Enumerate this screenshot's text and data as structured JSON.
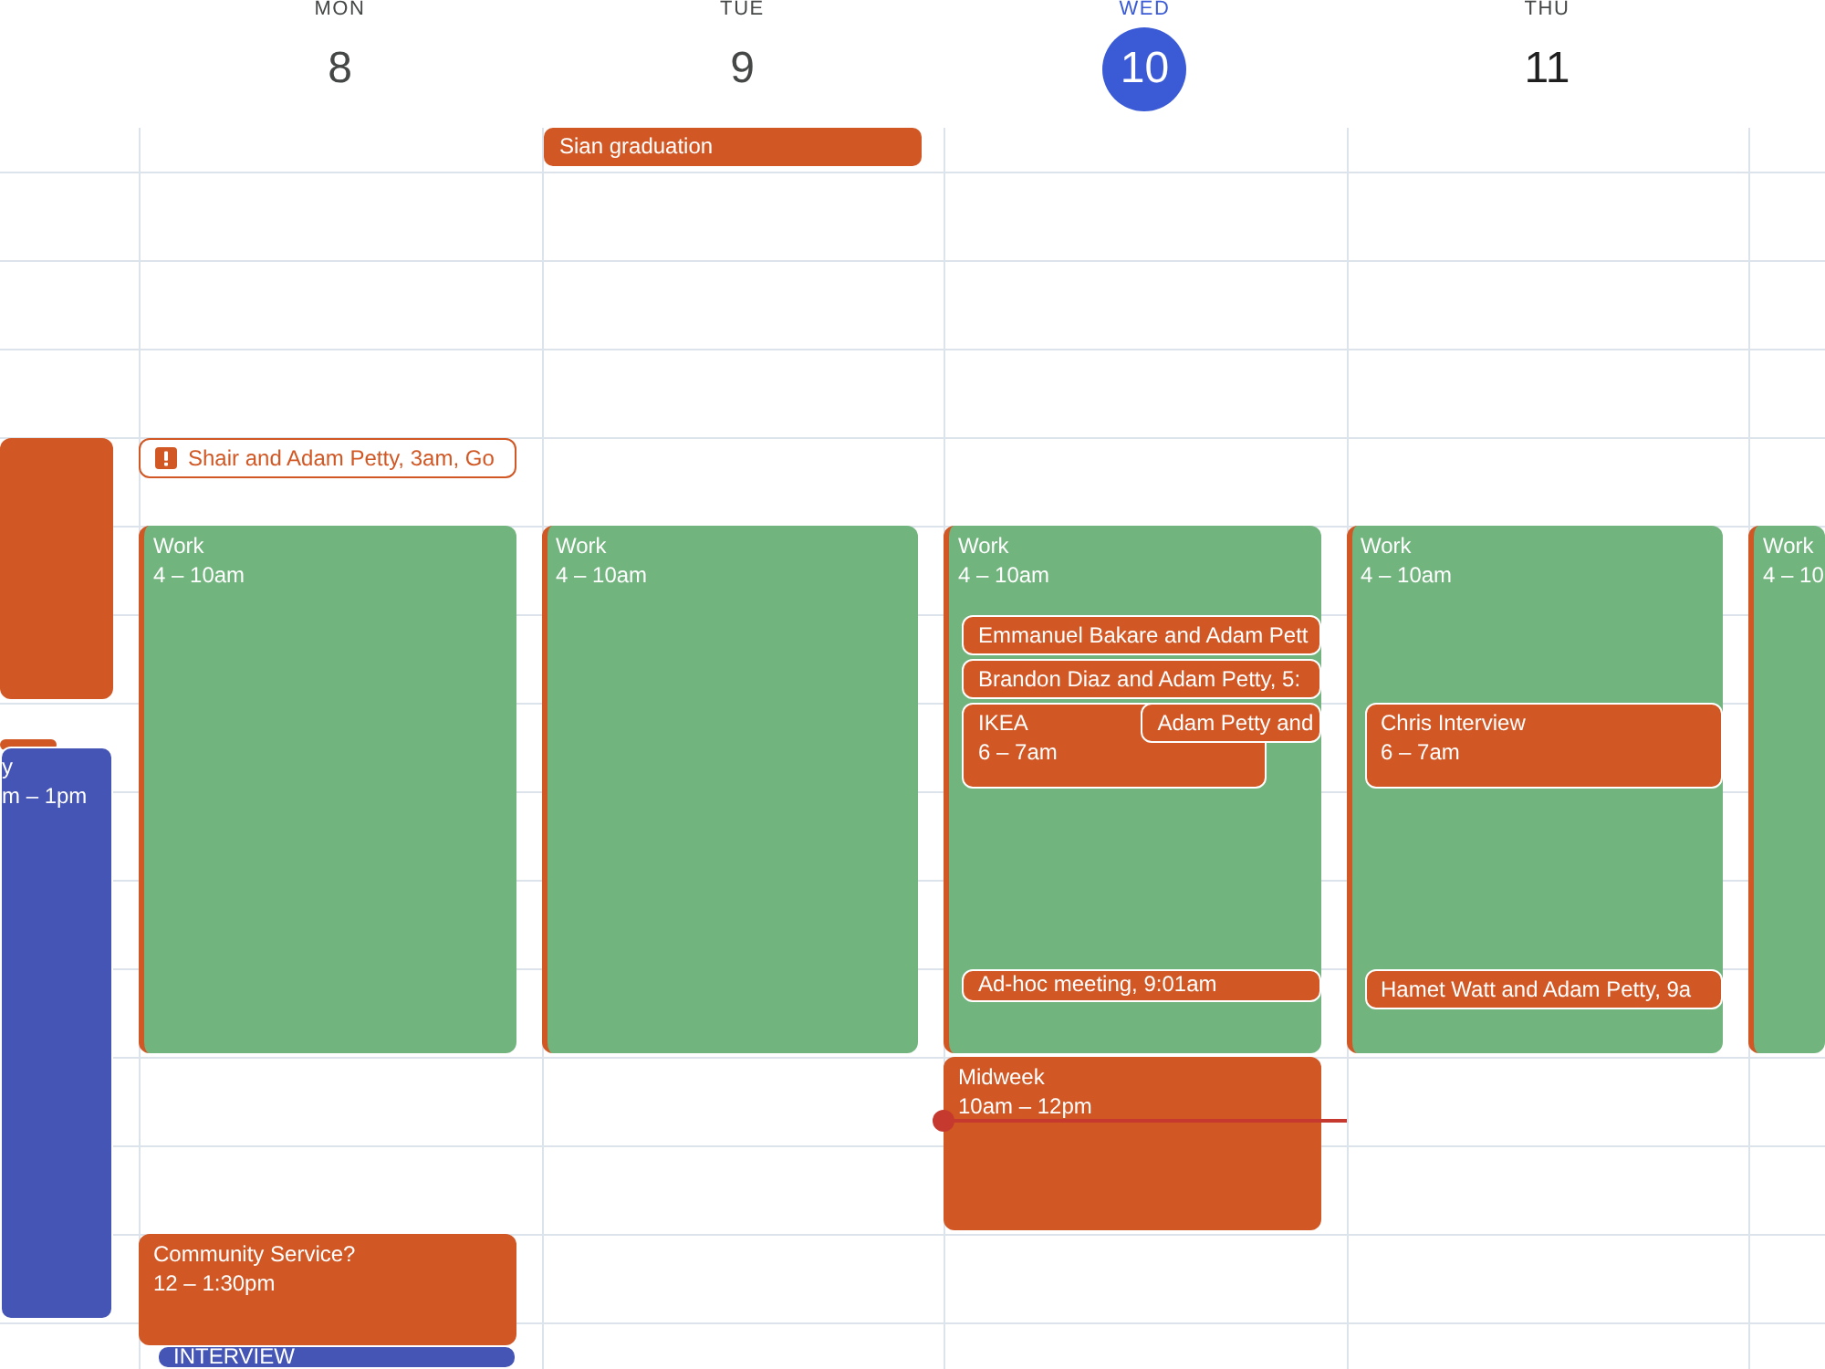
{
  "days": [
    {
      "selected": false,
      "events": [
        {
          "kind": "filled",
          "color": "#d15724"
        },
        {
          "kind": "filled",
          "color": "#d15724"
        },
        {
          "kind": "filled",
          "color": "#4455b5",
          "title": "y",
          "time": "m – 1pm"
        }
      ]
    },
    {
      "name": "MON",
      "date": "8",
      "selected": false,
      "past": true,
      "events": [
        {
          "kind": "outlined",
          "color": "#d15724",
          "title": "Shair and Adam Petty, 3am, Go"
        },
        {
          "kind": "filled",
          "color": "#72b47e",
          "stripe": {
            "color": "#d15724"
          },
          "title": "Work",
          "time": "4 – 10am"
        },
        {
          "kind": "filled",
          "color": "#d15724",
          "title": "Community Service?",
          "time": "12 – 1:30pm"
        },
        {
          "kind": "filled",
          "color": "#4455b5",
          "title": "INTERVIEW"
        }
      ]
    },
    {
      "name": "TUE",
      "date": "9",
      "selected": false,
      "past": true,
      "all_day": [
        {
          "title": "Sian graduation",
          "color": "#d15724"
        }
      ],
      "events": [
        {
          "kind": "filled",
          "color": "#72b47e",
          "stripe": {
            "color": "#d15724"
          },
          "title": "Work",
          "time": "4 – 10am"
        }
      ]
    },
    {
      "name": "WED",
      "date": "10",
      "selected": true,
      "past": false,
      "events": [
        {
          "kind": "filled",
          "color": "#72b47e",
          "stripe": {
            "color": "#d15724"
          },
          "title": "Work",
          "time": "4 – 10am"
        },
        {
          "kind": "filled",
          "color": "#d15724",
          "title": "Emmanuel Bakare and Adam Pett"
        },
        {
          "kind": "filled",
          "color": "#d15724",
          "title": "Brandon Diaz and Adam Petty, 5:"
        },
        {
          "kind": "filled",
          "color": "#d15724",
          "title": "IKEA",
          "time": "6 – 7am"
        },
        {
          "kind": "filled",
          "color": "#d15724",
          "title": "Adam Petty and"
        },
        {
          "kind": "filled",
          "color": "#d15724",
          "title": "Ad-hoc meeting, 9:01am"
        },
        {
          "kind": "filled",
          "color": "#d15724",
          "title": "Midweek",
          "time": "10am – 12pm"
        }
      ]
    },
    {
      "name": "THU",
      "date": "11",
      "selected": false,
      "past": false,
      "events": [
        {
          "kind": "filled",
          "color": "#72b47e",
          "stripe": {
            "color": "#d15724"
          },
          "title": "Work",
          "time": "4 – 10am"
        },
        {
          "kind": "filled",
          "color": "#d15724",
          "title": "Chris Interview",
          "time": "6 – 7am"
        },
        {
          "kind": "filled",
          "color": "#d15724",
          "title": "Hamet Watt and Adam Petty, 9a"
        }
      ]
    },
    {
      "selected": false,
      "events": [
        {
          "kind": "filled",
          "color": "#72b47e",
          "stripe": {
            "color": "#d15724"
          },
          "title": "Work",
          "time": "4 – 10"
        }
      ]
    }
  ]
}
